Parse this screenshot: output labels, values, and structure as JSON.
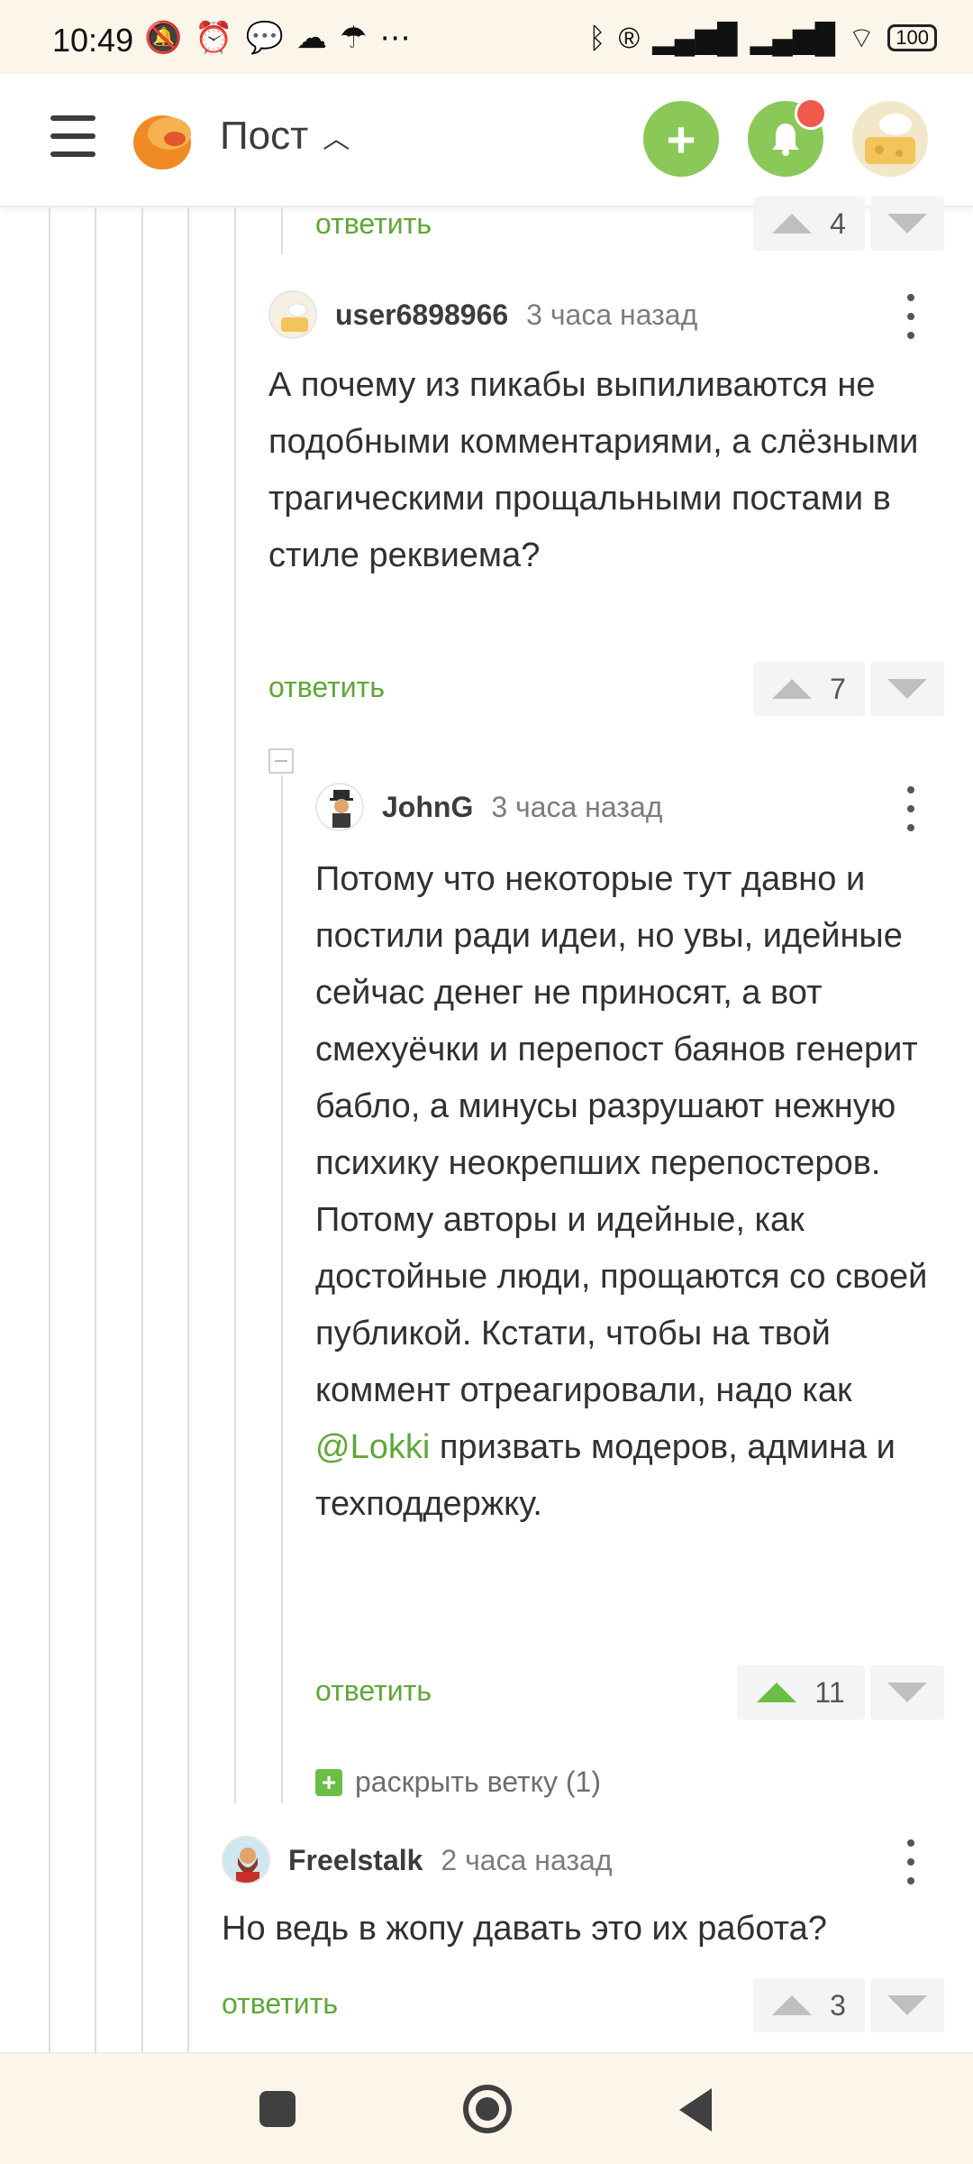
{
  "status_bar": {
    "time": "10:49",
    "battery": "100",
    "left_icons": [
      "muted-notifications-icon",
      "alarm-icon",
      "chat-icon",
      "cloud-icon",
      "umbrella-icon",
      "more-dots-icon"
    ],
    "right_icons": [
      "bluetooth-icon",
      "roaming-icon",
      "signal-icon",
      "signal-icon",
      "wifi-icon",
      "battery-icon"
    ]
  },
  "header": {
    "title": "Пост",
    "accent": "#8ac858",
    "notification_dot": "#f05a4c"
  },
  "comments": [
    {
      "reply": "ответить",
      "score": "4"
    },
    {
      "user": "user6898966",
      "time": "3 часа назад",
      "text": "А почему из пикабы выпиливаются не подобными комментариями, а слёзными трагическими прощальными постами в стиле реквиема?",
      "reply": "ответить",
      "score": "7"
    },
    {
      "user": "JohnG",
      "time": "3 часа назад",
      "text_before": "Потому что некоторые тут давно и постили ради идеи, но увы, идейные сейчас денег не приносят, а вот смехуёчки и перепост баянов генерит бабло, а минусы разрушают нежную психику неокрепших перепостеров. Потому авторы и идейные, как достойные люди, прощаются со своей публикой. Кстати, чтобы на твой коммент отреагировали, надо как ",
      "mention": "@Lokki",
      "text_after": " призвать модеров, админа и техподдержку.",
      "reply": "ответить",
      "score": "11",
      "expand": "раскрыть ветку (1)"
    },
    {
      "user": "Freelstalk",
      "time": "2 часа назад",
      "text": "Но ведь в жопу давать это их работа?",
      "reply": "ответить",
      "score": "3"
    }
  ],
  "colors": {
    "link_green": "#61a639",
    "upvote_active": "#6abe45",
    "status_bg": "#fbf5ea"
  }
}
